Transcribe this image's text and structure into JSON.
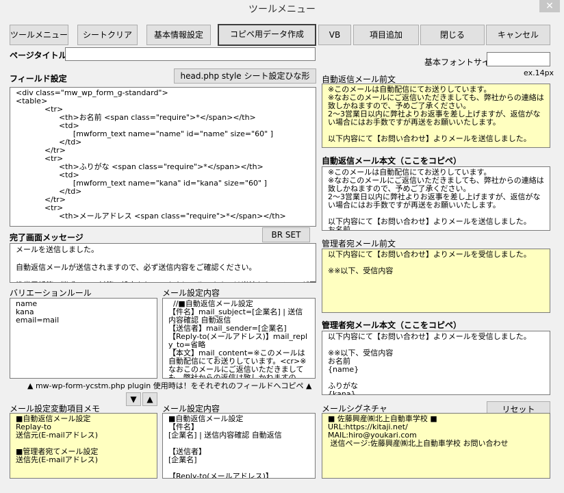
{
  "window": {
    "title": "ツールメニュー",
    "close_glyph": "✕"
  },
  "toolbar": {
    "buttons": [
      "ツールメニュー",
      "シートクリア",
      "基本情報設定",
      "コピペ用データ作成",
      "VB",
      "項目追加",
      "閉じる",
      "キャンセル"
    ]
  },
  "page_title": {
    "label": "ページタイトル",
    "value": ""
  },
  "base_font": {
    "label": "基本フォントサイズ",
    "value": "",
    "hint": "ex.14px"
  },
  "field": {
    "label": "フィールド設定",
    "button": "head.php style シート設定ひな形",
    "content": "<div class=\"mw_wp_form_g-standard\">\n<table>\n\t\t<tr>\n\t\t\t<th>お名前 <span class=\"require\">*</span></th>\n\t\t\t<td>\n\t\t\t\t[mwform_text name=\"name\" id=\"name\" size=\"60\" ]\n\t\t\t</td>\n\t\t</tr>\n\t\t<tr>\n\t\t\t<th>ふりがな <span class=\"require\">*</span></th>\n\t\t\t<td>\n\t\t\t\t[mwform_text name=\"kana\" id=\"kana\" size=\"60\" ]\n\t\t\t</td>\n\t\t</tr>\n\t\t<tr>\n\t\t\t<th>メールアドレス <span class=\"require\">*</span></th>"
  },
  "complete": {
    "label": "完了画面メッセージ",
    "button": "BR SET",
    "content": "メールを送信しました。\n\n自動返信メールが送信されますので、必ず送信内容をご確認ください。\n\n携帯電話等で迷惑メール対策の設定をしていますと、そのままでは当社からのメールが届かない"
  },
  "validation": {
    "label": "バリエーションルール",
    "content": "name\nkana\nemail=mail"
  },
  "mail_setting_1": {
    "label": "メール設定内容",
    "content": "  //■自動返信メール設定\n【件名】mail_subject=[企業名] | 送信内容確認 自動返信\n【送信者】mail_sender=[企業名]\n【Reply-to(メールアドレス)】mail_reply_to=省略\n【本文】mail_content=※このメールは自動配信にてお送りしています。<cr>※なおこのメールにご返信いただきましても、弊社からの返信は致しかねますので、予めご了承ください。"
  },
  "plugin_note": "▲ mw-wp-form-ycstm.php plugin 使用時は！をそれぞれのフィールドへコピペ ▲",
  "arrows": {
    "down": "▼",
    "up": "▲"
  },
  "memo": {
    "label": "メール設定変動項目メモ",
    "content": "■自動返信メール設定\nReplay-to\n送信元(E-mailアドレス)\n\n■管理者宛てメール設定\n送信先(E-mailアドレス)"
  },
  "mail_setting_2": {
    "label": "メール設定内容",
    "content": "■自動返信メール設定\n【件名】\n[企業名] | 送信内容確認 自動返信\n\n【送信者】\n[企業名]\n\n【Reply-to(メールアドレス)】"
  },
  "auto_reply_pre": {
    "label": "自動返信メール前文",
    "content": "※このメールは自動配信にてお送りしています。\n※なおこのメールにご返信いただきましても、弊社からの連絡は致しかねますので、予めご了承ください。\n2～3営業日以内に弊社よりお返事を差し上げますが、返信がない場合にはお手数ですが再送をお願いいたします。\n\n以下内容にて【お問い合わせ】よりメールを送信しました。"
  },
  "auto_reply_body": {
    "label": "自動返信メール本文（ここをコピペ）",
    "content": "※このメールは自動配信にてお送りしています。\n※なおこのメールにご返信いただきましても、弊社からの連絡は致しかねますので、予めご了承ください。\n2～3営業日以内に弊社よりお返事を差し上げますが、返信がない場合にはお手数ですが再送をお願いいたします。\n\n以下内容にて【お問い合わせ】よりメールを送信しました。\nお名前"
  },
  "admin_pre": {
    "label": "管理者宛メール前文",
    "content": "以下内容にて【お問い合わせ】よりメールを受信しました。\n\n※※以下、受信内容"
  },
  "admin_body": {
    "label": "管理者宛メール本文（ここをコピペ）",
    "content": "以下内容にて【お問い合わせ】よりメールを受信しました。\n\n※※以下、受信内容\nお名前\n{name}\n\nふりがな\n{kana}"
  },
  "signature": {
    "label": "メールシグネチャ",
    "button": "リセット",
    "content": "■ 佐藤興産㈱北上自動車学校 ■\nURL:https://kitaji.net/\nMAIL:hiro@youkari.com\n 送信ページ:佐藤興産㈱北上自動車学校 お問い合わせ"
  }
}
